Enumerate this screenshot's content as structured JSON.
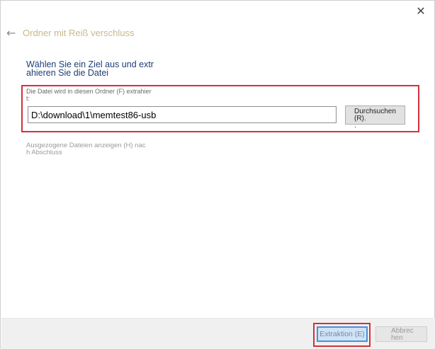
{
  "window": {
    "close_icon": "close-icon",
    "back_icon": "back-arrow-icon"
  },
  "title": "Ordner mit Reiß verschluss",
  "heading": {
    "line1": "Wählen Sie ein Ziel aus und extr",
    "line2": "ahieren Sie die Datei"
  },
  "destination": {
    "label_line1": "Die Datei wird in diesen Ordner (F) extrahier",
    "label_line2": "t:",
    "path_value": "D:\\download\\1\\memtest86-usb",
    "browse_line1": "Durchsuchen (R).",
    "browse_line2": "."
  },
  "show_files": {
    "line1": "Ausgezogene Dateien anzeigen (H) nac",
    "line2": "h Abschluss"
  },
  "footer": {
    "extract_label": "Extraktion (E)",
    "cancel_line1": "Abbrec",
    "cancel_line2": "hen"
  },
  "colors": {
    "highlight": "#d1323a",
    "focus": "#4a90d9",
    "heading": "#1e3d78"
  }
}
